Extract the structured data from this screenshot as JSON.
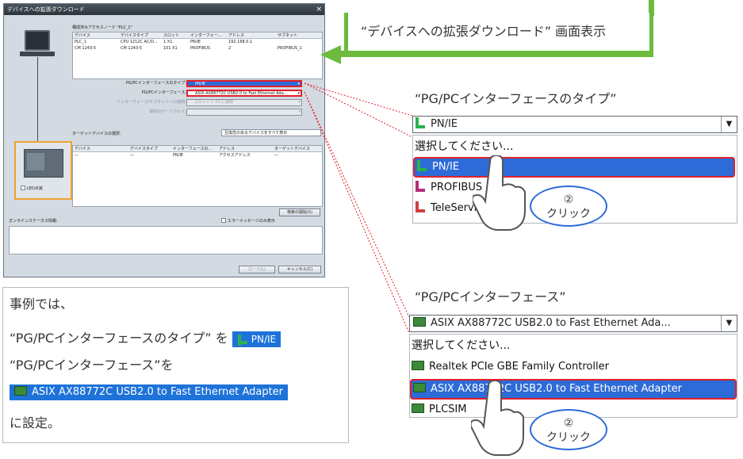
{
  "dialog": {
    "title": "デバイスへの拡張ダウンロード",
    "close": "×",
    "configured_nodes_label": "構成済みアクセスノード \"PLC_1\"",
    "table": {
      "headers": [
        "デバイス",
        "デバイスタイプ",
        "スロット",
        "インターフェー...",
        "アドレス",
        "サブネット"
      ],
      "rows": [
        [
          "PLC_1",
          "CPU 1212C AC/D...",
          "1 X1",
          "PN/IE",
          "192.168.0.1",
          ""
        ],
        [
          "CM 1243-5",
          "CM 1243-5",
          "101 X1",
          "PROFIBUS",
          "2",
          "PROFIBUS_1"
        ]
      ]
    },
    "form": {
      "type_label": "PG/PCインターフェースのタイプ:",
      "type_value": "PN/IE",
      "iface_label": "PG/PCインターフェース:",
      "iface_value": "ASIX AX88772C USB2.0 to Fast Ethernet Ada...",
      "subnet_label": "インターフェース/サブネットへの接続:",
      "subnet_value": "スロット'1 X1'に接続",
      "gateway_label": "最初のゲートウェイ:"
    },
    "target_label": "ターゲットデバイスの選択:",
    "target_filter": "互換性のあるデバイスをすべて表示",
    "target_table": {
      "headers": [
        "デバイス",
        "デバイスタイプ",
        "インターフェースの...",
        "アドレス",
        "ターゲットデバイス"
      ],
      "rows": [
        [
          "—",
          "—",
          "PN/IE",
          "アクセスアドレス",
          "—"
        ]
      ]
    },
    "led_label": "LED点滅",
    "search_button": "検索の開始(S)",
    "status_label": "オンラインステータス情報:",
    "errors_only": "エラーメッセージのみ表示",
    "load_button": "ロード(L)",
    "cancel_button": "キャンセル(C)"
  },
  "callout": {
    "text": "“デバイスへの拡張ダウンロード” 画面表示"
  },
  "note": {
    "line1": "事例では、",
    "line2_prefix": "“PG/PCインターフェースのタイプ” を",
    "chip1": "PN/IE",
    "line3": "“PG/PCインターフェース”を",
    "chip2": "ASIX AX88772C USB2.0 to Fast Ethernet Adapter",
    "line5": "に設定。"
  },
  "zoom_type": {
    "label": "“PG/PCインターフェースのタイプ”",
    "combo_value": "PN/IE",
    "items": [
      "選択してください...",
      "PN/IE",
      "PROFIBUS",
      "TeleService"
    ],
    "bubble_num": "②",
    "bubble_text": "クリック"
  },
  "zoom_iface": {
    "label": "“PG/PCインターフェース”",
    "combo_value": "ASIX AX88772C USB2.0 to Fast Ethernet Ada...",
    "items": [
      "選択してください...",
      "Realtek PCIe GBE Family Controller",
      "ASIX AX88772C USB2.0 to Fast Ethernet Adapter",
      "PLCSIM"
    ],
    "bubble_num": "②",
    "bubble_text": "クリック"
  },
  "colors": {
    "accent_green": "#6cbb3c",
    "selection_blue": "#2d6bd8",
    "highlight_red": "#e0202a"
  }
}
